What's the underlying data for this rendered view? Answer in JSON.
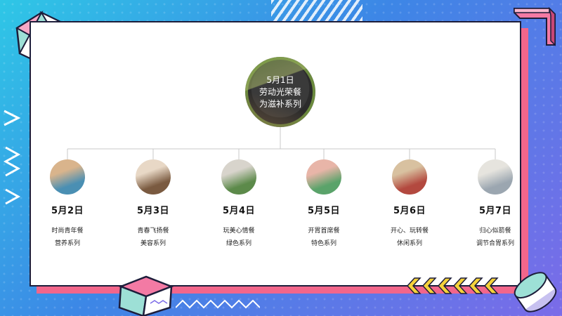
{
  "center": {
    "date": "5月1日",
    "line1": "劳动光荣餐",
    "line2": "为滋补系列"
  },
  "nodes": [
    {
      "date": "5月2日",
      "line1": "时尚青年餐",
      "line2": "营养系列",
      "photo": "sea-lake-photo",
      "c1": "#4a8fb3",
      "c2": "#d9b48c"
    },
    {
      "date": "5月3日",
      "line1": "青春飞扬餐",
      "line2": "美容系列",
      "photo": "coffee-cup-photo",
      "c1": "#7a5a40",
      "c2": "#e8d8c6"
    },
    {
      "date": "5月4日",
      "line1": "玩美心情餐",
      "line2": "绿色系列",
      "photo": "green-building-photo",
      "c1": "#5c8a4a",
      "c2": "#d8d4cc"
    },
    {
      "date": "5月5日",
      "line1": "开胃首席餐",
      "line2": "特色系列",
      "photo": "palm-plant-photo",
      "c1": "#5aa36a",
      "c2": "#e8b5a8"
    },
    {
      "date": "5月6日",
      "line1": "开心、玩转餐",
      "line2": "休闲系列",
      "photo": "sand-sign-photo",
      "c1": "#b3493f",
      "c2": "#d8c1a0"
    },
    {
      "date": "5月7日",
      "line1": "归心似箭餐",
      "line2": "调节合胃系列",
      "photo": "white-building-photo",
      "c1": "#9ba6b0",
      "c2": "#e6e4de"
    }
  ],
  "colors": {
    "accent_pink": "#f2668b",
    "accent_yellow": "#f5d23a",
    "bg_start": "#2ec7e6",
    "bg_end": "#7b6be8"
  }
}
